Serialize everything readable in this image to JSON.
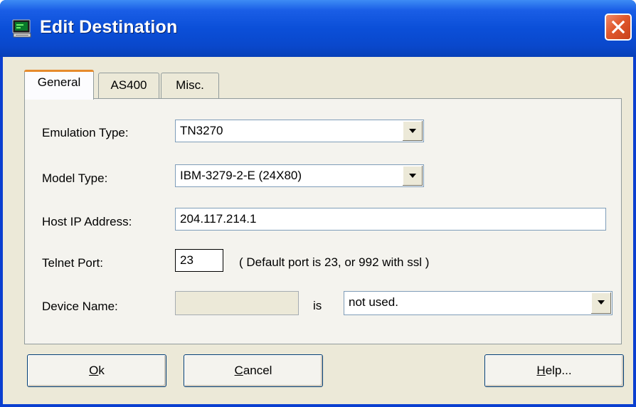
{
  "window": {
    "title": "Edit Destination",
    "app_icon": "terminal-icon",
    "close_icon": "close-icon"
  },
  "tabs": [
    {
      "label": "General",
      "active": true
    },
    {
      "label": "AS400",
      "active": false
    },
    {
      "label": "Misc.",
      "active": false
    }
  ],
  "form": {
    "emulation_type": {
      "label": "Emulation Type:",
      "value": "TN3270"
    },
    "model_type": {
      "label": "Model Type:",
      "value": "IBM-3279-2-E (24X80)"
    },
    "host_ip": {
      "label": "Host IP Address:",
      "value": "204.117.214.1"
    },
    "telnet_port": {
      "label": "Telnet Port:",
      "value": "23",
      "hint": "( Default port is 23, or 992 with ssl )"
    },
    "device_name": {
      "label": "Device Name:",
      "value": "",
      "is_label": "is",
      "mode": "not used."
    }
  },
  "buttons": {
    "ok": {
      "mnemonic": "O",
      "rest": "k"
    },
    "cancel": {
      "mnemonic": "C",
      "rest": "ancel"
    },
    "help": {
      "mnemonic": "H",
      "rest": "elp..."
    }
  },
  "colors": {
    "titlebar": "#0b4fd8",
    "close_button": "#e0582c",
    "dialog_bg": "#ece9d8",
    "active_tab_highlight": "#e68b2c"
  }
}
